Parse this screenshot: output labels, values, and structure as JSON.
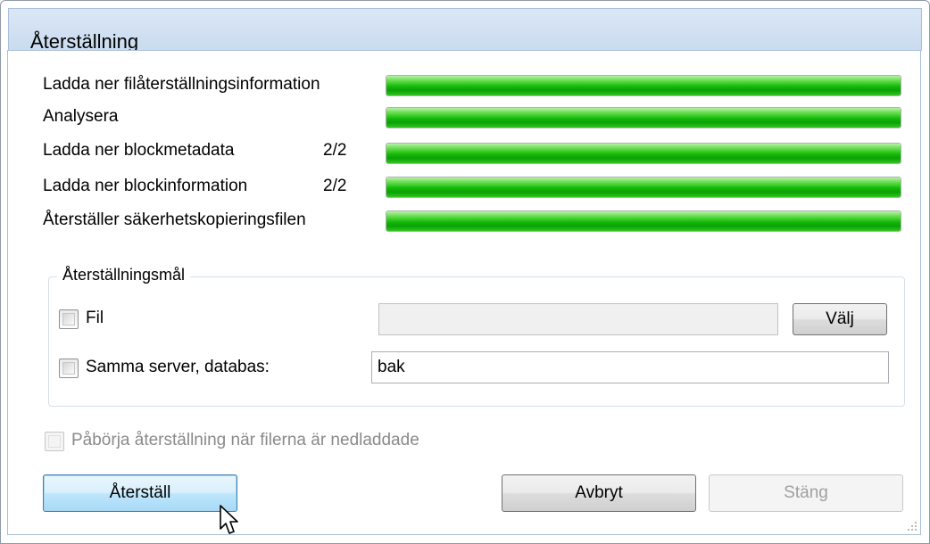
{
  "window": {
    "title": "Återställning"
  },
  "steps": [
    {
      "label": "Ladda ner filåterställningsinformation",
      "count": "",
      "progress": 1.0
    },
    {
      "label": "Analysera",
      "count": "",
      "progress": 1.0
    },
    {
      "label": "Ladda ner blockmetadata",
      "count": "2/2",
      "progress": 1.0
    },
    {
      "label": "Ladda ner blockinformation",
      "count": "2/2",
      "progress": 1.0
    },
    {
      "label": "Återställer säkerhetskopieringsfilen",
      "count": "",
      "progress": 1.0
    }
  ],
  "target_group": {
    "title": "Återställningsmål",
    "file_option": {
      "label": "Fil",
      "checked": false,
      "value": "",
      "button": "Välj"
    },
    "server_option": {
      "label": "Samma server, databas:",
      "checked": false,
      "value": "bak"
    }
  },
  "auto_start": {
    "label": "Påbörja återställning när filerna är nedladdade",
    "checked": false,
    "enabled": false
  },
  "buttons": {
    "restore": "Återställ",
    "cancel": "Avbryt",
    "close": "Stäng"
  },
  "colors": {
    "progress_fill": "#12b809",
    "title_bar": "#c9dbef",
    "default_button": "#bee6fd"
  },
  "icons": {
    "cursor": "arrow-cursor-icon",
    "grip": "resize-grip-icon"
  }
}
